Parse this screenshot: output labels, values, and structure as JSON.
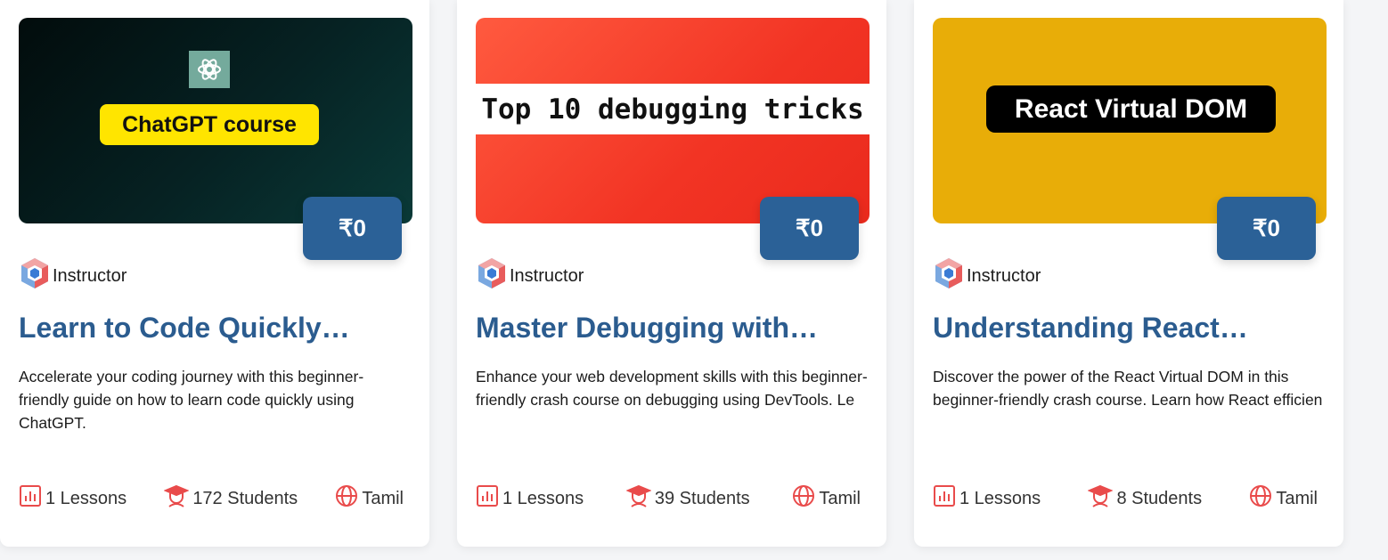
{
  "colors": {
    "accent": "#2b6197",
    "title": "#2b5c8f",
    "icon": "#e94b4b"
  },
  "courses": [
    {
      "thumbnail_text": "ChatGPT course",
      "price": "₹0",
      "instructor_label": "Instructor",
      "title": "Learn to Code Quickly…",
      "description": "Accelerate your coding journey with this beginner-friendly guide on how to learn code quickly using ChatGPT.",
      "lessons": "1 Lessons",
      "students": "172 Students",
      "language": "Tamil"
    },
    {
      "thumbnail_text": "Top 10 debugging tricks",
      "price": "₹0",
      "instructor_label": "Instructor",
      "title": "Master Debugging with…",
      "description": "Enhance your web development skills with this beginner-friendly crash course on debugging using DevTools. Le",
      "lessons": "1 Lessons",
      "students": "39 Students",
      "language": "Tamil"
    },
    {
      "thumbnail_text": "React Virtual DOM",
      "price": "₹0",
      "instructor_label": "Instructor",
      "title": "Understanding React…",
      "description": "Discover the power of the React Virtual DOM in this beginner-friendly crash course. Learn how React efficien",
      "lessons": "1 Lessons",
      "students": "8 Students",
      "language": "Tamil"
    }
  ],
  "icons": {
    "logo": "instructor-logo-icon",
    "openai": "openai-logo-icon",
    "lessons": "bar-chart-icon",
    "students": "graduate-icon",
    "language": "globe-icon"
  }
}
